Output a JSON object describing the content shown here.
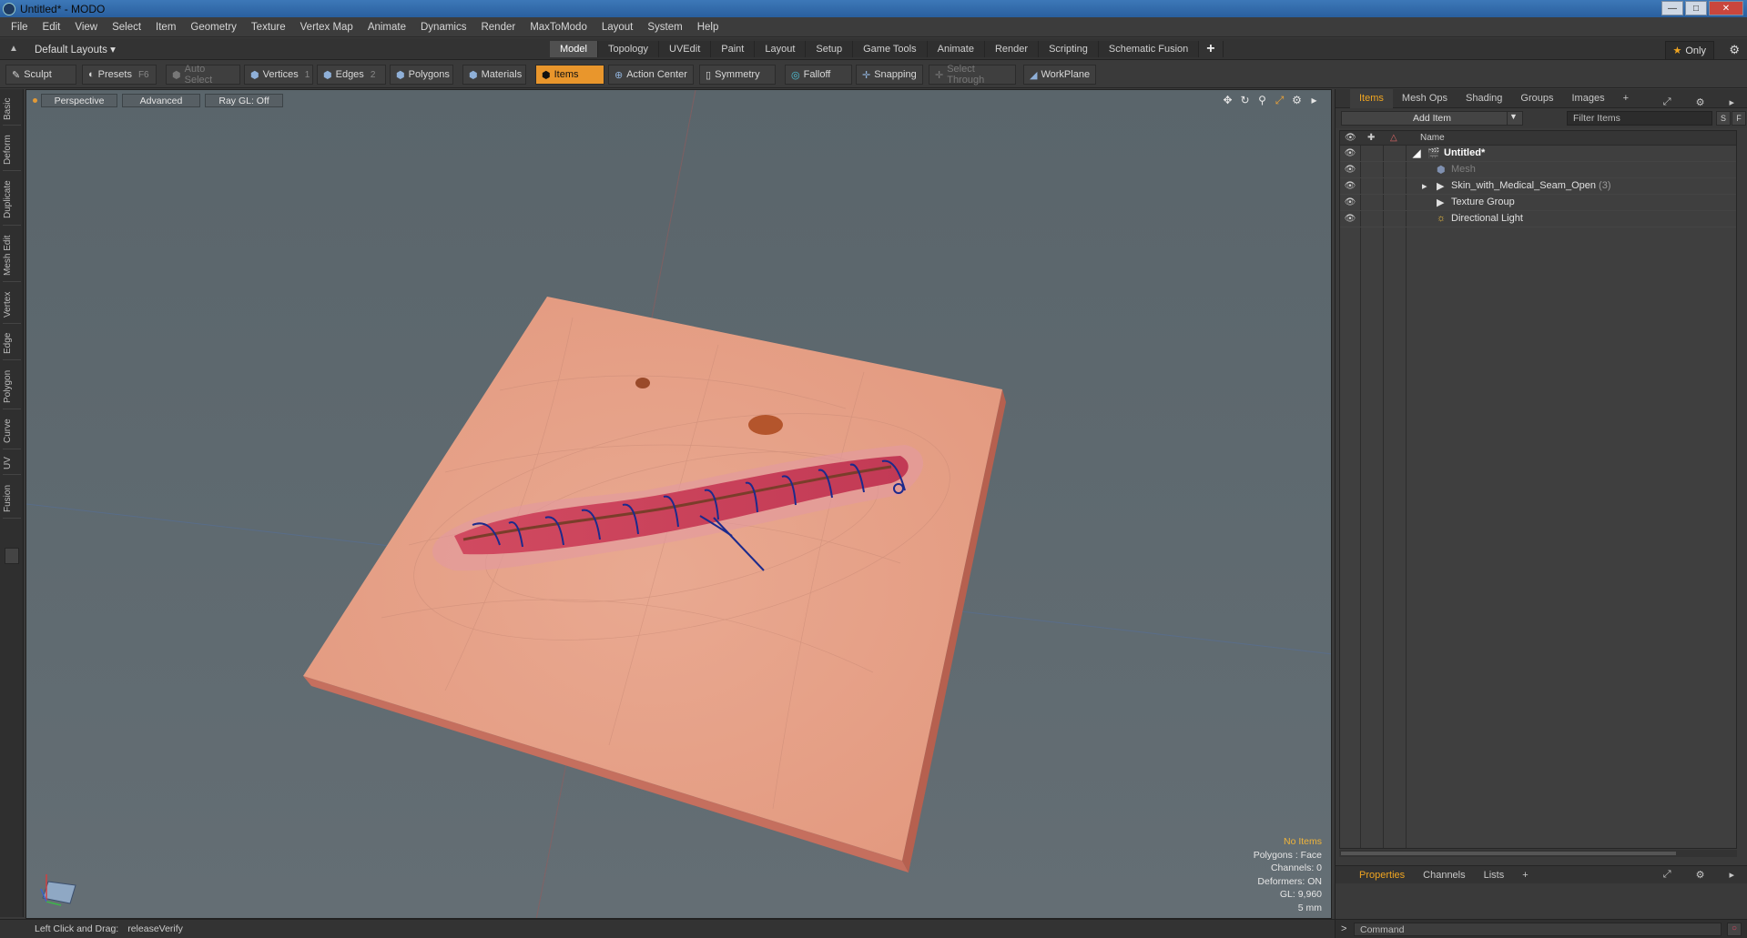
{
  "window": {
    "title": "Untitled* - MODO",
    "controls": [
      "minimize",
      "maximize",
      "close"
    ]
  },
  "menubar": {
    "items": [
      "File",
      "Edit",
      "View",
      "Select",
      "Item",
      "Geometry",
      "Texture",
      "Vertex Map",
      "Animate",
      "Dynamics",
      "Render",
      "MaxToModo",
      "Layout",
      "System",
      "Help"
    ]
  },
  "layoutbar": {
    "layout_selector": "Default Layouts ▾",
    "tabs": [
      "Model",
      "Topology",
      "UVEdit",
      "Paint",
      "Layout",
      "Setup",
      "Game Tools",
      "Animate",
      "Render",
      "Scripting",
      "Schematic Fusion"
    ],
    "active_tab": "Model",
    "only_label": "Only"
  },
  "toolbar": {
    "sculpt": "Sculpt",
    "presets": "Presets",
    "presets_key": "F6",
    "auto_select": "Auto Select",
    "vertices": "Vertices",
    "vertices_key": "1",
    "edges": "Edges",
    "edges_key": "2",
    "polygons": "Polygons",
    "materials": "Materials",
    "items": "Items",
    "action_center": "Action Center",
    "symmetry": "Symmetry",
    "falloff": "Falloff",
    "snapping": "Snapping",
    "select_through": "Select Through",
    "workplane": "WorkPlane"
  },
  "left_tabs": [
    "Basic",
    "Deform",
    "Duplicate",
    "Mesh Edit",
    "Vertex",
    "Edge",
    "Polygon",
    "Curve",
    "UV",
    "Fusion"
  ],
  "viewport": {
    "view_mode": "Perspective",
    "shading": "Advanced",
    "raygl": "Ray GL: Off",
    "info": {
      "selection": "No Items",
      "polygons": "Polygons : Face",
      "channels": "Channels: 0",
      "deformers": "Deformers: ON",
      "gl": "GL: 9,960",
      "grid": "5 mm"
    }
  },
  "statusbar": {
    "hint_label": "Left Click and Drag:",
    "hint_value": "releaseVerify"
  },
  "right_panel": {
    "tabs": [
      "Items",
      "Mesh Ops",
      "Shading",
      "Groups",
      "Images"
    ],
    "active_tab": "Items",
    "add_item": "Add Item",
    "filter_placeholder": "Filter Items",
    "s_btn": "S",
    "f_btn": "F",
    "column_name": "Name",
    "tree": [
      {
        "label": "Untitled*",
        "level": 0,
        "expanded": true,
        "bold": true
      },
      {
        "label": "Mesh",
        "level": 1,
        "dim": true
      },
      {
        "label": "Skin_with_Medical_Seam_Open",
        "count": "(3)",
        "level": 1,
        "collapsed": true
      },
      {
        "label": "Texture Group",
        "level": 1
      },
      {
        "label": "Directional Light",
        "level": 1
      }
    ],
    "properties_tabs": [
      "Properties",
      "Channels",
      "Lists"
    ],
    "properties_active": "Properties",
    "command_placeholder": "Command"
  },
  "colors": {
    "accent": "#f0a521",
    "active_button": "#e9962c",
    "viewport_bg": "#5f6a70",
    "skin": "#e8a38a",
    "wound": "#c9465a",
    "suture": "#1c2a8c"
  }
}
